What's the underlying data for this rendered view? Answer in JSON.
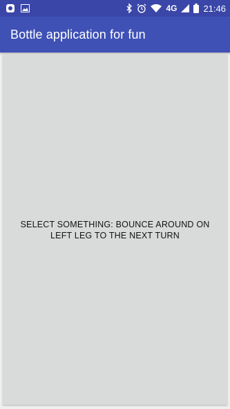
{
  "status_bar": {
    "network_type": "4G",
    "time": "21:46",
    "icons": [
      "notification-app-icon",
      "image-icon",
      "bluetooth-icon",
      "alarm-icon",
      "wifi-icon",
      "cell-signal-icon",
      "battery-icon"
    ]
  },
  "app_bar": {
    "title": "Bottle application for fun",
    "color": "#3f51b5"
  },
  "content": {
    "instruction": "SELECT SOMETHING: BOUNCE AROUND ON LEFT LEG TO THE NEXT TURN",
    "background": "#d9dbda"
  }
}
